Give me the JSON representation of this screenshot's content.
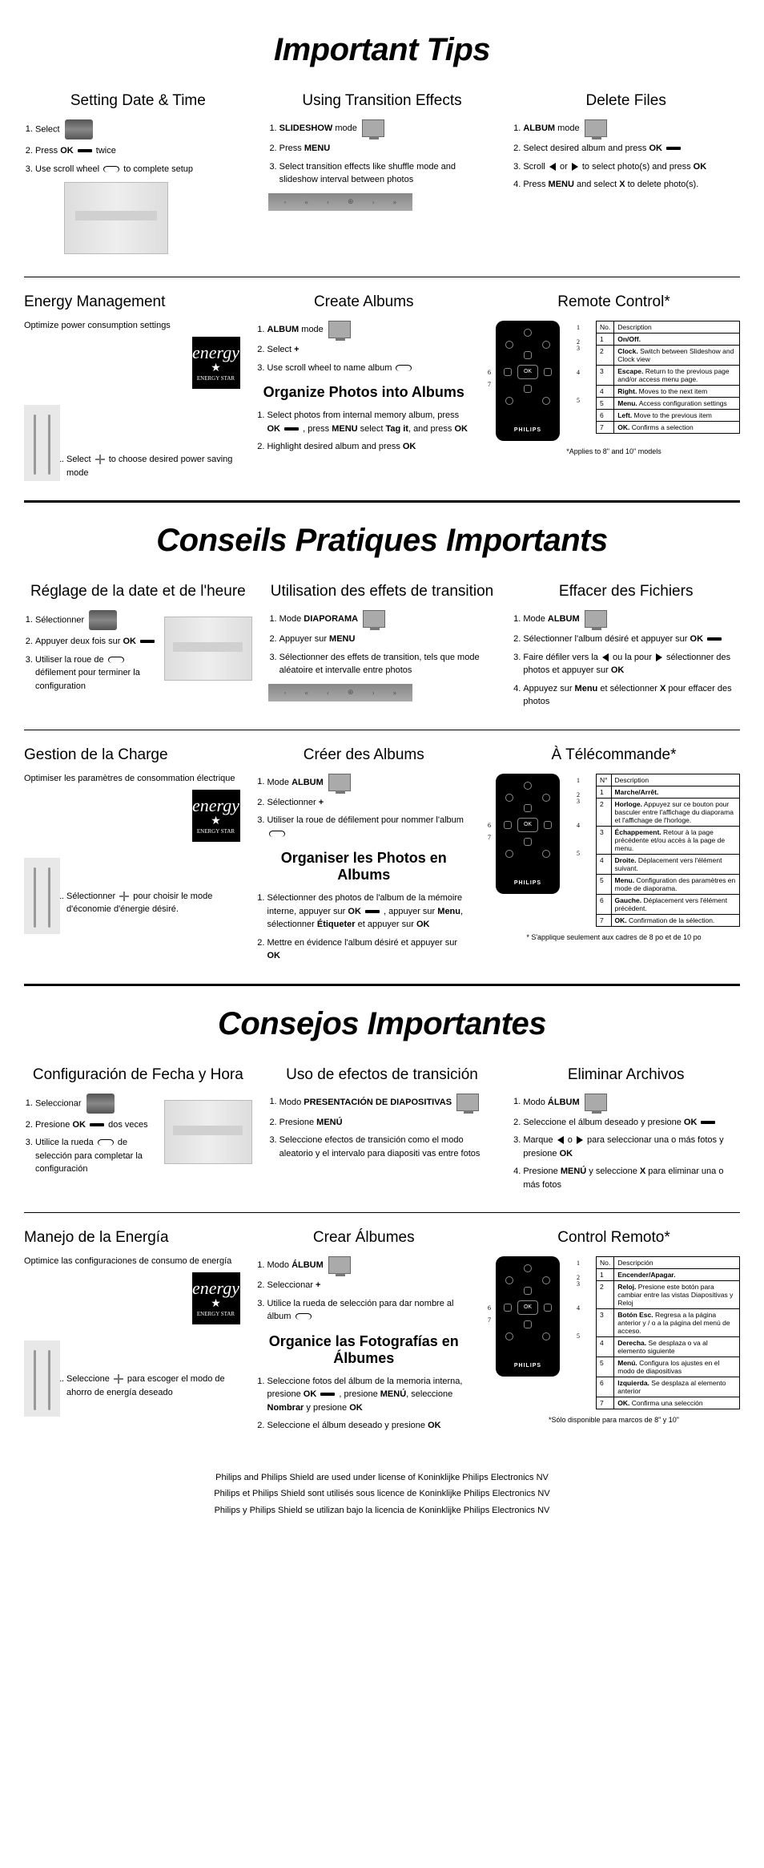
{
  "en": {
    "title": "Important Tips",
    "datetime": {
      "heading": "Setting Date & Time",
      "s1a": "Select",
      "s2a": "Press ",
      "s2b": "OK",
      "s2c": " twice",
      "s3a": "Use scroll wheel ",
      "s3b": " to complete setup"
    },
    "transition": {
      "heading": "Using Transition Effects",
      "s1a": "SLIDESHOW",
      "s1b": " mode",
      "s2a": "Press ",
      "s2b": "MENU",
      "s3": "Select transition effects like shuffle mode and slideshow interval between photos"
    },
    "delete": {
      "heading": "Delete Files",
      "s1a": "ALBUM",
      "s1b": " mode",
      "s2a": "Select desired album and press ",
      "s2b": "OK",
      "s3a": "Scroll ",
      "s3b": " or ",
      "s3c": " to select photo(s) and press ",
      "s3d": "OK",
      "s4a": "Press ",
      "s4b": "MENU",
      "s4c": " and select ",
      "s4d": "X",
      "s4e": " to delete photo(s)."
    },
    "energy": {
      "heading": "Energy Management",
      "sub": "Optimize power consumption settings",
      "estar": "ENERGY STAR",
      "s1a": "Select ",
      "s1b": " to choose desired power saving mode"
    },
    "create": {
      "heading": "Create Albums",
      "s1a": "ALBUM",
      "s1b": " mode",
      "s2a": "Select ",
      "s2b": "+",
      "s3a": "Use scroll wheel to name album "
    },
    "organize": {
      "heading": "Organize Photos into Albums",
      "s1a": "Select photos from internal memory album, press ",
      "s1b": "OK",
      "s1c": " , press ",
      "s1d": "MENU",
      "s1e": " select ",
      "s1f": "Tag it",
      "s1g": ", and press ",
      "s1h": "OK",
      "s2a": "Highlight desired album and press ",
      "s2b": "OK"
    },
    "remote": {
      "heading": "Remote Control*",
      "brand": "PHILIPS",
      "note": "*Applies to 8\" and 10\" models",
      "th_no": "No.",
      "th_desc": "Description",
      "rows": [
        {
          "n": "1",
          "b": "On/Off.",
          "d": ""
        },
        {
          "n": "2",
          "b": "Clock.",
          "d": " Switch between Slideshow and Clock view"
        },
        {
          "n": "3",
          "b": "Escape.",
          "d": " Return to the previous page and/or access menu page."
        },
        {
          "n": "4",
          "b": "Right.",
          "d": " Moves to the next item"
        },
        {
          "n": "5",
          "b": "Menu.",
          "d": " Access configuration settings"
        },
        {
          "n": "6",
          "b": "Left.",
          "d": " Move to the previous item"
        },
        {
          "n": "7",
          "b": "OK.",
          "d": " Confirms a selection"
        }
      ]
    }
  },
  "fr": {
    "title": "Conseils Pratiques Importants",
    "datetime": {
      "heading": "Réglage de la date et de l'heure",
      "s1a": "Sélectionner",
      "s2a": "Appuyer deux fois sur ",
      "s2b": "OK",
      "s3a": "Utiliser la roue de ",
      "s3b": " défilement pour terminer la configuration"
    },
    "transition": {
      "heading": "Utilisation des effets de transition",
      "s1a": "Mode ",
      "s1b": "DIAPORAMA",
      "s2a": "Appuyer sur ",
      "s2b": "MENU",
      "s3": "Sélectionner des effets de transition, tels que mode aléatoire et intervalle entre photos"
    },
    "delete": {
      "heading": "Effacer des Fichiers",
      "s1a": "Mode ",
      "s1b": "ALBUM",
      "s2a": "Sélectionner l'album désiré et appuyer sur ",
      "s2b": "OK",
      "s3a": "Faire défiler vers la ",
      "s3b": " ou la pour ",
      "s3c": " sélectionner des photos et appuyer sur ",
      "s3d": "OK",
      "s4a": "Appuyez sur ",
      "s4b": "Menu",
      "s4c": " et sélectionner ",
      "s4d": "X",
      "s4e": " pour effacer des photos"
    },
    "energy": {
      "heading": "Gestion de la Charge",
      "sub": "Optimiser les paramètres de consommation électrique",
      "estar": "ENERGY STAR",
      "s1a": "Sélectionner ",
      "s1b": " pour choisir le mode d'économie d'énergie désiré."
    },
    "create": {
      "heading": "Créer des Albums",
      "s1a": "Mode ",
      "s1b": "ALBUM",
      "s2a": "Sélectionner ",
      "s2b": "+",
      "s3a": "Utiliser la roue de défilement pour nommer l'album "
    },
    "organize": {
      "heading": "Organiser les Photos en Albums",
      "s1a": "Sélectionner des photos de l'album de la mémoire interne, appuyer sur ",
      "s1b": "OK",
      "s1c": " , appuyer sur ",
      "s1d": "Menu",
      "s1e": ", sélectionner ",
      "s1f": "Étiqueter",
      "s1g": " et appuyer sur ",
      "s1h": "OK",
      "s2a": "Mettre en évidence l'album désiré et appuyer sur ",
      "s2b": "OK"
    },
    "remote": {
      "heading": "À Télécommande*",
      "brand": "PHILIPS",
      "note": "* S'applique seulement aux cadres de 8 po et de 10 po",
      "th_no": "N°",
      "th_desc": "Description",
      "rows": [
        {
          "n": "1",
          "b": "Marche/Arrêt.",
          "d": ""
        },
        {
          "n": "2",
          "b": "Horloge.",
          "d": " Appuyez sur ce bouton pour basculer entre l'affichage du diaporama et l'affichage de l'horloge."
        },
        {
          "n": "3",
          "b": "Échappement.",
          "d": " Retour à la page précédente et/ou accès à la page de menu."
        },
        {
          "n": "4",
          "b": "Droite.",
          "d": " Déplacement vers l'élément suivant."
        },
        {
          "n": "5",
          "b": "Menu.",
          "d": " Configuration des paramètres en mode de diaporama."
        },
        {
          "n": "6",
          "b": "Gauche.",
          "d": " Déplacement vers l'élément précédent."
        },
        {
          "n": "7",
          "b": "OK.",
          "d": " Confirmation de la sélection."
        }
      ]
    }
  },
  "es": {
    "title": "Consejos Importantes",
    "datetime": {
      "heading": "Configuración de Fecha y Hora",
      "s1a": "Seleccionar",
      "s2a": "Presione ",
      "s2b": "OK",
      "s2c": " dos veces",
      "s3a": "Utilice la rueda ",
      "s3b": " de selección para completar la configuración"
    },
    "transition": {
      "heading": "Uso de efectos de transición",
      "s1a": "Modo ",
      "s1b": "PRESENTACIÓN DE DIAPOSITIVAS",
      "s2a": "Presione ",
      "s2b": "MENÚ",
      "s3": "Seleccione efectos de transición como el modo aleatorio y el intervalo para diapositi vas entre fotos"
    },
    "delete": {
      "heading": "Eliminar Archivos",
      "s1a": "Modo ",
      "s1b": "ÁLBUM",
      "s2a": "Seleccione el álbum deseado y presione ",
      "s2b": "OK",
      "s3a": "Marque ",
      "s3b": " o ",
      "s3c": " para seleccionar una o más fotos y presione ",
      "s3d": "OK",
      "s4a": "Presione ",
      "s4b": "MENÚ",
      "s4c": " y seleccione ",
      "s4d": "X",
      "s4e": " para eliminar una o más fotos"
    },
    "energy": {
      "heading": "Manejo de la Energía",
      "sub": "Optimice las configuraciones de consumo de energía",
      "estar": "ENERGY STAR",
      "s1a": "Seleccione ",
      "s1b": " para escoger el modo de ahorro de energía deseado"
    },
    "create": {
      "heading": "Crear Álbumes",
      "s1a": "Modo ",
      "s1b": "ÁLBUM",
      "s2a": "Seleccionar ",
      "s2b": "+",
      "s3a": "Utilice la rueda de selección para dar nombre al álbum "
    },
    "organize": {
      "heading": "Organice las Fotografías en Álbumes",
      "s1a": "Seleccione fotos del álbum de la memoria interna, presione ",
      "s1b": "OK",
      "s1c": " , presione ",
      "s1d": "MENÚ",
      "s1e": ", seleccione ",
      "s1f": "Nombrar",
      "s1g": " y presione ",
      "s1h": "OK",
      "s2a": "Seleccione el álbum deseado y presione ",
      "s2b": "OK"
    },
    "remote": {
      "heading": "Control Remoto*",
      "brand": "PHILIPS",
      "note": "*Sólo disponible para marcos de 8\" y 10\"",
      "th_no": "No.",
      "th_desc": "Descripción",
      "rows": [
        {
          "n": "1",
          "b": "Encender/Apagar.",
          "d": ""
        },
        {
          "n": "2",
          "b": "Reloj.",
          "d": " Presione este botón para cambiar entre las vistas Diapositivas y Reloj"
        },
        {
          "n": "3",
          "b": "Botón Esc.",
          "d": " Regresa a la página anterior y / o a la página del menú de acceso."
        },
        {
          "n": "4",
          "b": "Derecha.",
          "d": " Se desplaza o va al elemento siguiente"
        },
        {
          "n": "5",
          "b": "Menú.",
          "d": " Configura los ajustes en el modo de diapositivas"
        },
        {
          "n": "6",
          "b": "Izquierda.",
          "d": " Se desplaza al elemento anterior"
        },
        {
          "n": "7",
          "b": "OK.",
          "d": " Confirma una selección"
        }
      ]
    }
  },
  "remote_callouts": [
    "1",
    "2",
    "3",
    "4",
    "5",
    "6",
    "7"
  ],
  "remote_ok": "OK",
  "footer": {
    "l1": "Philips and Philips Shield are used under license of Koninklijke Philips Electronics NV",
    "l2": "Philips et Philips Shield sont utilisés sous licence de Koninklijke Philips Electronics NV",
    "l3": "Philips y Philips Shield se utilizan bajo la licencia de Koninklijke Philips Electronics NV"
  }
}
